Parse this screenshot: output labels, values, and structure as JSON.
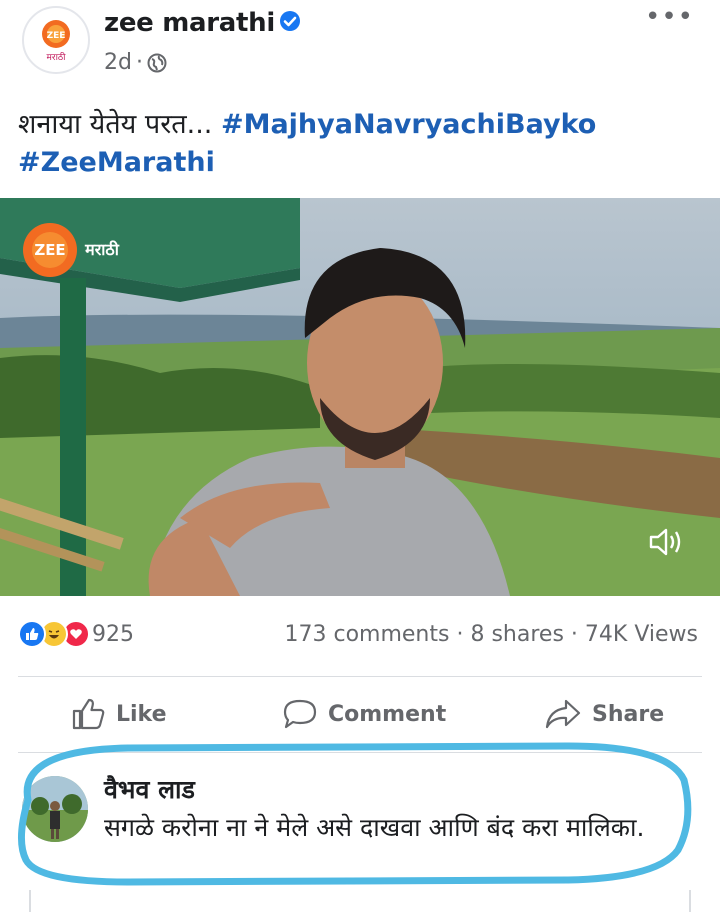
{
  "post": {
    "page_name": "zee marathi",
    "time": "2d",
    "meta_separator": "·",
    "privacy_icon": "globe-icon",
    "verified_icon": "verified-badge-icon",
    "more_icon": "more-options-icon",
    "more_label": "•••",
    "avatar_logo_top": "ZEE",
    "avatar_logo_bottom": "मराठी",
    "caption_text": "शनाया येतेय परत... ",
    "hashtag_1": "#MajhyaNavryachiBayko",
    "hashtag_2": "#ZeeMarathi"
  },
  "video": {
    "watermark_zee": "ZEE",
    "watermark_marathi": "मराठी",
    "volume_icon": "volume-icon"
  },
  "stats": {
    "reaction_icons": [
      "like-icon",
      "haha-icon",
      "love-icon"
    ],
    "reaction_count": "925",
    "comments": "173 comments",
    "shares": "8 shares",
    "views": "74K Views",
    "separator": "·"
  },
  "actions": {
    "like": "Like",
    "comment": "Comment",
    "share": "Share"
  },
  "comment": {
    "author": "वैभव लाड",
    "text": "सगळे करोना ना ने मेले असे दाखवा आणि बंद करा मालिका."
  },
  "colors": {
    "link_blue": "#1d5fb4",
    "verified_blue": "#1877f2",
    "meta_grey": "#65676b",
    "highlight_cyan": "#4fb9e3"
  }
}
